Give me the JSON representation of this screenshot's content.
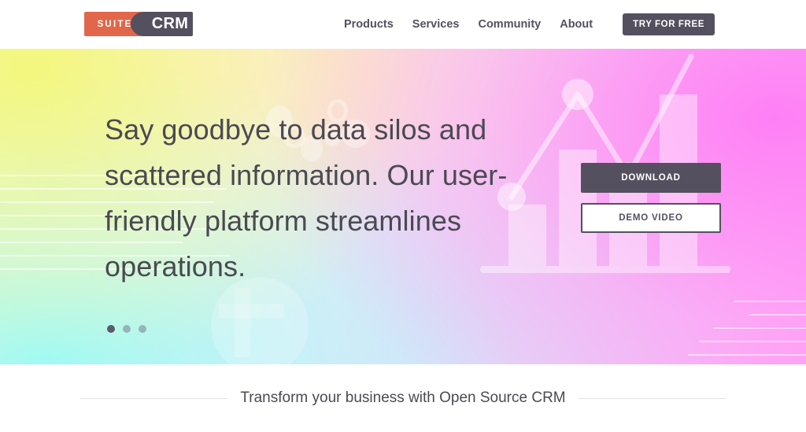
{
  "header": {
    "logo": {
      "suite": "SUITE",
      "crm": "CRM",
      "suite_bg": "#e2674a",
      "crm_bg": "#55505f"
    },
    "nav": [
      {
        "label": "Products"
      },
      {
        "label": "Services"
      },
      {
        "label": "Community"
      },
      {
        "label": "About"
      }
    ],
    "cta": {
      "label": "TRY FOR FREE",
      "bg": "#55505f",
      "color": "#ffffff"
    }
  },
  "hero": {
    "title": "Say goodbye to data silos and scattered information. Our user-friendly platform streamlines operations.",
    "buttons": {
      "download": "DOWNLOAD",
      "demo": "DEMO VIDEO"
    },
    "carousel": {
      "total": 3,
      "active_index": 0
    },
    "gradient": {
      "top_left": "#f4f8bd",
      "top_right": "#ffa6f7",
      "bottom_left": "#96fafa",
      "bottom_right": "#ffc4ee"
    }
  },
  "tagline": {
    "text": "Transform your business with Open Source CRM"
  }
}
